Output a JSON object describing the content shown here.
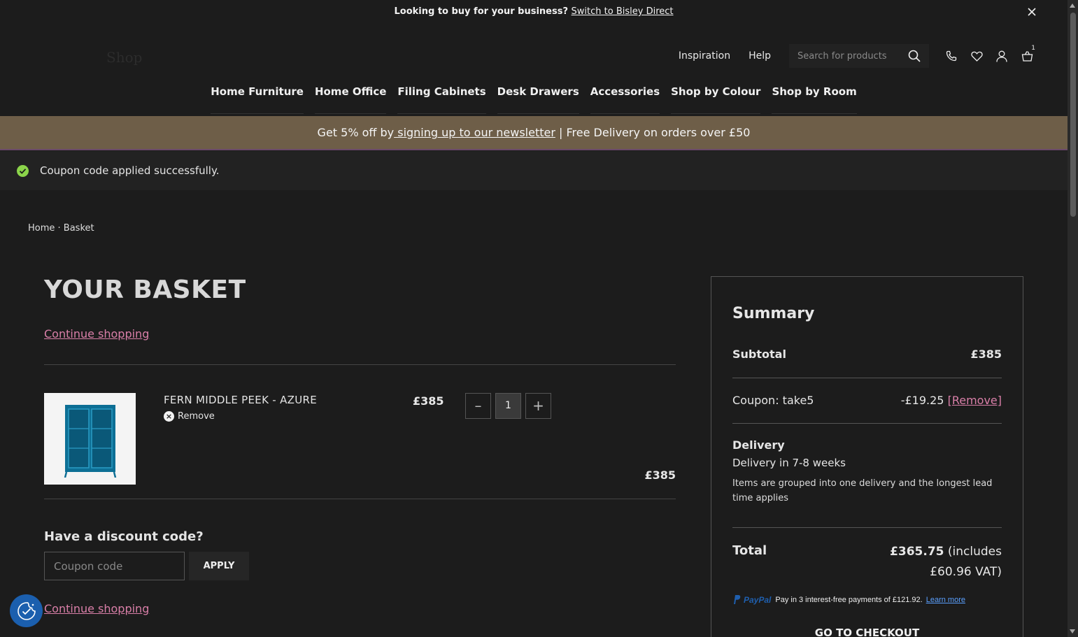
{
  "topbar": {
    "prompt": "Looking to buy for your business?",
    "link": "Switch to Bisley Direct"
  },
  "header": {
    "logo": "Shop",
    "util_links": [
      "Inspiration",
      "Help"
    ],
    "search_placeholder": "Search for products",
    "basket_count": "1"
  },
  "main_nav": [
    "Home Furniture",
    "Home Office",
    "Filing Cabinets",
    "Desk Drawers",
    "Accessories",
    "Shop by Colour",
    "Shop by Room"
  ],
  "promo": {
    "pre": "Get 5% off by",
    "link": " signing up to our newsletter",
    "post": " | Free Delivery on orders over £50"
  },
  "notice": {
    "message": "Coupon code applied successfully.",
    "color": "#8bd44a"
  },
  "breadcrumb": {
    "home": "Home",
    "sep": " · ",
    "current": "Basket"
  },
  "basket": {
    "title": "YOUR BASKET",
    "continue_label": "Continue shopping",
    "item": {
      "name": "FERN MIDDLE PEEK - AZURE",
      "remove_label": "Remove",
      "unit_price": "£385",
      "quantity": "1",
      "line_total": "£385",
      "product_color": "#0d6f95"
    },
    "discount": {
      "title": "Have a discount code?",
      "placeholder": "Coupon code",
      "apply_label": "APPLY"
    }
  },
  "summary": {
    "title": "Summary",
    "subtotal_label": "Subtotal",
    "subtotal_value": "£385",
    "coupon_label": "Coupon: take5",
    "coupon_value": "-£19.25",
    "coupon_remove": "[Remove]",
    "delivery_title": "Delivery",
    "delivery_time": "Delivery in 7-8 weeks",
    "delivery_note": "Items are grouped into one delivery and the longest lead time applies",
    "total_label": "Total",
    "total_value": "£365.75",
    "total_vat_1": " (includes",
    "total_vat_2": "£60.96 VAT)",
    "paypal_brand": "PayPal",
    "paypal_text": "Pay in 3 interest-free payments of £121.92.",
    "paypal_learn": "Learn more",
    "checkout_label": "GO TO CHECKOUT"
  },
  "colors": {
    "background": "#1c1c1c",
    "promo_bar": "#6e5e48",
    "accent_link": "#d97fa8",
    "cookie_button": "#1b5fae"
  }
}
